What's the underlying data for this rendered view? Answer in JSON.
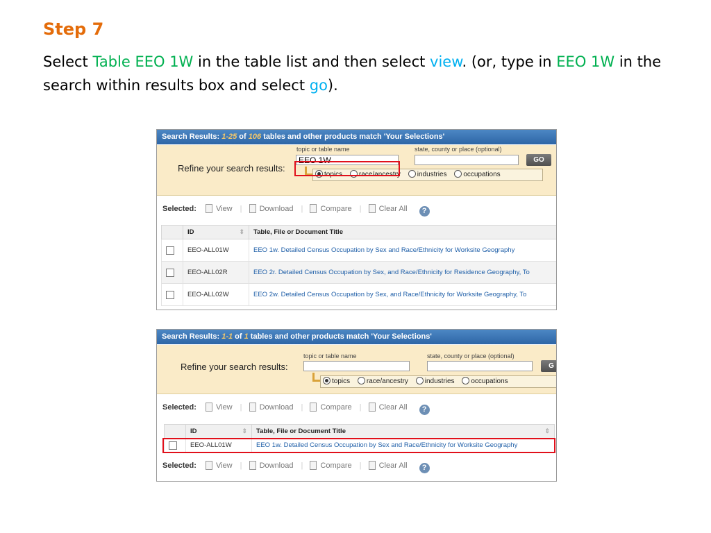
{
  "slide": {
    "title": "Step 7",
    "instr": {
      "p1": "Select ",
      "hl1": "Table EEO 1W",
      "p2": " in the table list and then select ",
      "hl2": "view",
      "p3": ". (or, type in ",
      "hl3": "EEO 1W",
      "p4": " in the search within results box and select ",
      "hl4": "go",
      "p5": ")."
    }
  },
  "shot1": {
    "header": {
      "prefix": "Search Results: ",
      "range": "1-25",
      "of": " of ",
      "total": "106",
      "suffix": " tables and other products match 'Your Selections'"
    },
    "refine_label": "Refine your search results:",
    "topic_label": "topic or table name",
    "topic_value": "EEO 1W",
    "place_label": "state, county or place (optional)",
    "go": "GO",
    "radios": [
      "topics",
      "race/ancestry",
      "industries",
      "occupations"
    ],
    "toolbar": {
      "selected": "Selected:",
      "view": "View",
      "download": "Download",
      "compare": "Compare",
      "clear": "Clear All",
      "help": "?"
    },
    "columns": {
      "id": "ID",
      "title": "Table, File or Document Title"
    },
    "rows": [
      {
        "id": "EEO-ALL01W",
        "title": "EEO 1w. Detailed Census Occupation by Sex and Race/Ethnicity for Worksite Geography"
      },
      {
        "id": "EEO-ALL02R",
        "title": "EEO 2r. Detailed Census Occupation by Sex, and Race/Ethnicity for Residence Geography, To"
      },
      {
        "id": "EEO-ALL02W",
        "title": "EEO 2w. Detailed Census Occupation by Sex, and Race/Ethnicity for Worksite Geography, To"
      }
    ]
  },
  "shot2": {
    "header": {
      "prefix": "Search Results: ",
      "range": "1-1",
      "of": " of ",
      "total": "1",
      "suffix": " tables and other products match 'Your Selections'"
    },
    "refine_label": "Refine your search results:",
    "topic_label": "topic or table name",
    "topic_value": "",
    "place_label": "state, county or place (optional)",
    "go": "G",
    "radios": [
      "topics",
      "race/ancestry",
      "industries",
      "occupations"
    ],
    "toolbar": {
      "selected": "Selected:",
      "view": "View",
      "download": "Download",
      "compare": "Compare",
      "clear": "Clear All",
      "help": "?"
    },
    "columns": {
      "id": "ID",
      "title": "Table, File or Document Title"
    },
    "rows": [
      {
        "id": "EEO-ALL01W",
        "title": "EEO 1w. Detailed Census Occupation by Sex and Race/Ethnicity for Worksite Geography"
      }
    ]
  }
}
